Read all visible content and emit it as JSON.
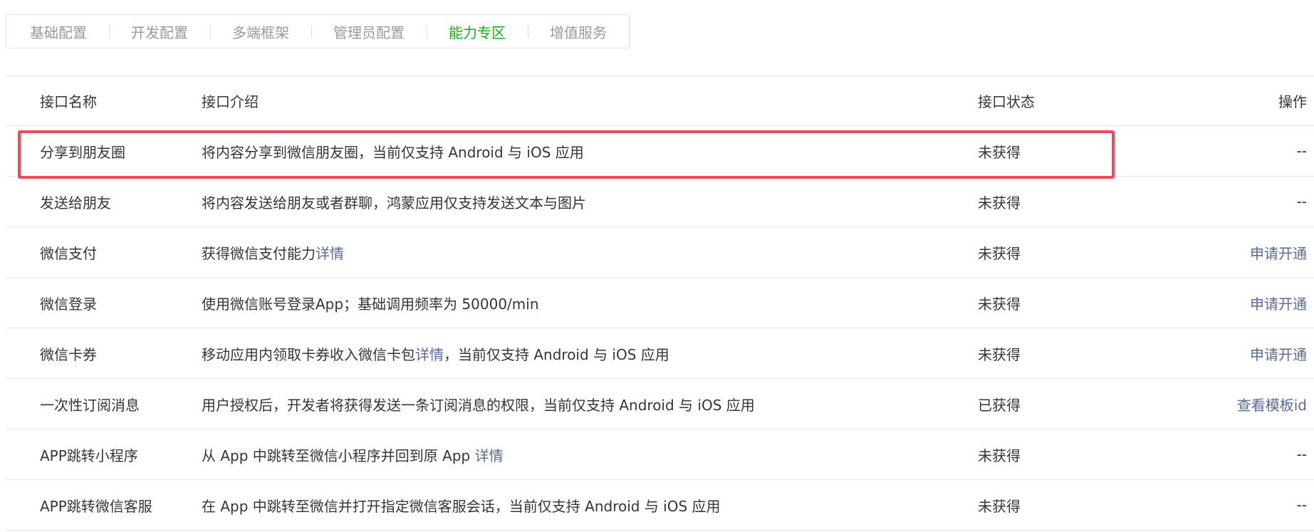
{
  "tabs": [
    {
      "label": "基础配置",
      "active": false
    },
    {
      "label": "开发配置",
      "active": false
    },
    {
      "label": "多端框架",
      "active": false
    },
    {
      "label": "管理员配置",
      "active": false
    },
    {
      "label": "能力专区",
      "active": true
    },
    {
      "label": "增值服务",
      "active": false
    }
  ],
  "table": {
    "headers": {
      "name": "接口名称",
      "desc": "接口介绍",
      "status": "接口状态",
      "op": "操作"
    },
    "rows": [
      {
        "name": "分享到朋友圈",
        "desc": "将内容分享到微信朋友圈，当前仅支持 Android 与 iOS 应用",
        "desc_link": "",
        "desc_tail": "",
        "status": "未获得",
        "op": "--",
        "op_is_link": false
      },
      {
        "name": "发送给朋友",
        "desc": "将内容发送给朋友或者群聊，鸿蒙应用仅支持发送文本与图片",
        "desc_link": "",
        "desc_tail": "",
        "status": "未获得",
        "op": "--",
        "op_is_link": false
      },
      {
        "name": "微信支付",
        "desc": "获得微信支付能力",
        "desc_link": "详情",
        "desc_tail": "",
        "status": "未获得",
        "op": "申请开通",
        "op_is_link": true
      },
      {
        "name": "微信登录",
        "desc": "使用微信账号登录App；基础调用频率为 50000/min",
        "desc_link": "",
        "desc_tail": "",
        "status": "未获得",
        "op": "申请开通",
        "op_is_link": true
      },
      {
        "name": "微信卡券",
        "desc": "移动应用内领取卡券收入微信卡包",
        "desc_link": "详情",
        "desc_tail": "，当前仅支持 Android 与 iOS 应用",
        "status": "未获得",
        "op": "申请开通",
        "op_is_link": true
      },
      {
        "name": "一次性订阅消息",
        "desc": "用户授权后，开发者将获得发送一条订阅消息的权限，当前仅支持 Android 与 iOS 应用",
        "desc_link": "",
        "desc_tail": "",
        "status": "已获得",
        "op": "查看模板id",
        "op_is_link": true
      },
      {
        "name": "APP跳转小程序",
        "desc": "从 App 中跳转至微信小程序并回到原 App ",
        "desc_link": "详情",
        "desc_tail": "",
        "status": "未获得",
        "op": "--",
        "op_is_link": false
      },
      {
        "name": "APP跳转微信客服",
        "desc": "在 App 中跳转至微信并打开指定微信客服会话，当前仅支持 Android 与 iOS 应用",
        "desc_link": "",
        "desc_tail": "",
        "status": "未获得",
        "op": "--",
        "op_is_link": false
      }
    ]
  },
  "colors": {
    "tab_active": "#1aad19",
    "tab_inactive": "#9a9a9a",
    "link": "#576b95",
    "highlight_border": "#f04a56",
    "row_divider": "#e7e7eb"
  }
}
